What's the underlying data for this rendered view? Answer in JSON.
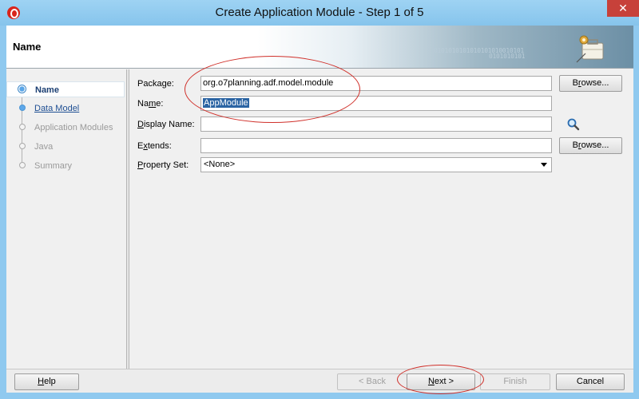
{
  "window": {
    "title": "Create Application Module - Step 1 of 5",
    "close_glyph": "✕"
  },
  "header": {
    "title": "Name",
    "decor_binary_1": "0101010101010101010010101",
    "decor_binary_2": "0101010101"
  },
  "nav": {
    "items": [
      {
        "label": "Name",
        "state": "selected"
      },
      {
        "label": "Data Model",
        "state": "link"
      },
      {
        "label": "Application Modules",
        "state": "disabled"
      },
      {
        "label": "Java",
        "state": "disabled"
      },
      {
        "label": "Summary",
        "state": "disabled"
      }
    ]
  },
  "form": {
    "package": {
      "label_pre": "Package:",
      "value": "org.o7planning.adf.model.module"
    },
    "name": {
      "label_pre": "Na",
      "label_u": "m",
      "label_post": "e:",
      "value": "AppModule"
    },
    "display_name": {
      "label_pre": "",
      "label_u": "D",
      "label_post": "isplay Name:",
      "value": ""
    },
    "extends": {
      "label_pre": "E",
      "label_u": "x",
      "label_post": "tends:",
      "value": ""
    },
    "property_set": {
      "label_pre": "",
      "label_u": "P",
      "label_post": "roperty Set:",
      "value": "<None>"
    },
    "browse_label_pre": "B",
    "browse_label_u": "r",
    "browse_label_post": "owse..."
  },
  "footer": {
    "help": {
      "u": "H",
      "rest": "elp"
    },
    "back": "< Back",
    "next": {
      "u": "N",
      "rest": "ext >"
    },
    "finish": "Finish",
    "cancel": "Cancel"
  },
  "colors": {
    "title_bar": "#8fc9ef",
    "close_button": "#c7413a",
    "selection": "#2b64a3",
    "annotation": "#d0302a"
  },
  "icons": [
    "app-logo-icon",
    "close-icon",
    "wizard-briefcase-icon",
    "search-icon",
    "select-arrow-icon"
  ]
}
